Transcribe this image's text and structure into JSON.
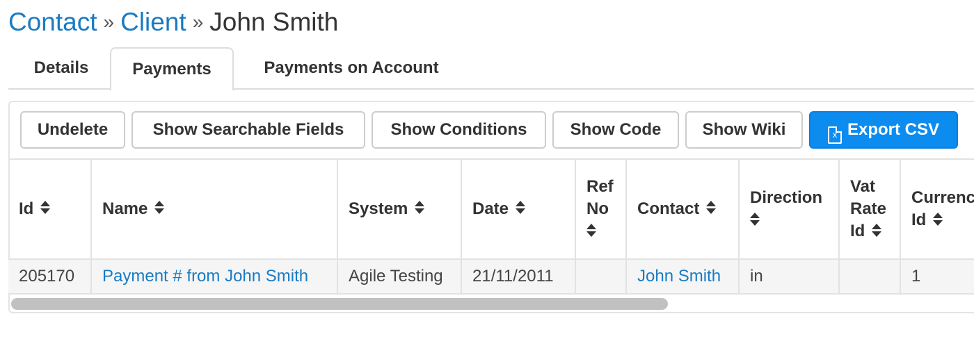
{
  "breadcrumb": {
    "items": [
      "Contact",
      "Client"
    ],
    "separator": "»",
    "current": "John Smith"
  },
  "tabs": [
    {
      "label": "Details",
      "active": false
    },
    {
      "label": "Payments",
      "active": true
    },
    {
      "label": "Payments on Account",
      "active": false
    }
  ],
  "toolbar": {
    "undelete": "Undelete",
    "show_searchable_fields": "Show Searchable Fields",
    "show_conditions": "Show Conditions",
    "show_code": "Show Code",
    "show_wiki": "Show Wiki",
    "export_csv": "Export CSV",
    "export_icon": "excel-file-icon",
    "export_icon_glyph": "x",
    "primary_color": "#0d8cf0"
  },
  "table": {
    "columns": [
      {
        "key": "id",
        "lines": [
          "Id"
        ]
      },
      {
        "key": "name",
        "lines": [
          "Name"
        ]
      },
      {
        "key": "system",
        "lines": [
          "System"
        ]
      },
      {
        "key": "date",
        "lines": [
          "Date"
        ]
      },
      {
        "key": "ref_no",
        "lines": [
          "Ref",
          "No"
        ]
      },
      {
        "key": "contact",
        "lines": [
          "Contact"
        ]
      },
      {
        "key": "direction",
        "lines": [
          "Direction"
        ]
      },
      {
        "key": "vat_rate_id",
        "lines": [
          "Vat",
          "Rate",
          "Id"
        ]
      },
      {
        "key": "currency_id",
        "lines": [
          "Currenc",
          "Id"
        ]
      }
    ],
    "rows": [
      {
        "id": "205170",
        "name": "Payment # from John Smith",
        "system": "Agile Testing",
        "date": "21/11/2011",
        "ref_no": "",
        "contact": "John Smith",
        "direction": "in",
        "vat_rate_id": "",
        "currency_id": "1"
      }
    ]
  },
  "colors": {
    "link": "#1a7bc2",
    "row_background": "#f5f5f5"
  }
}
